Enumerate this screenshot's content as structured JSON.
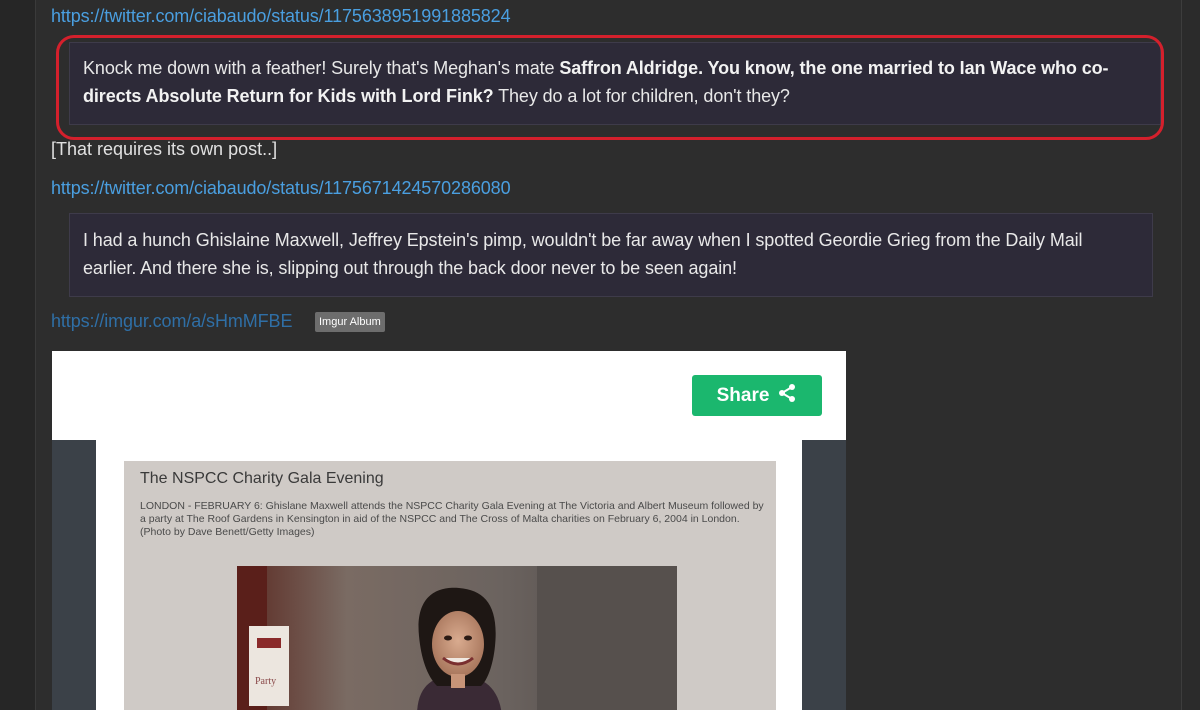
{
  "post": {
    "link1": "https://twitter.com/ciabaudo/status/1175638951991885824",
    "quote1": {
      "prefix": "Knock me down with a feather! Surely that's Meghan's mate ",
      "bold": "Saffron Aldridge. You know, the one married to Ian Wace who co-directs Absolute Return for Kids with Lord Fink?",
      "suffix": " They do a lot for children, don't they?"
    },
    "note": "[That requires its own post..]",
    "link2": "https://twitter.com/ciabaudo/status/1175671424570286080",
    "quote2": "I had a hunch Ghislaine Maxwell, Jeffrey Epstein's pimp, wouldn't be far away when I spotted Geordie Grieg from the Daily Mail earlier. And there she is, slipping out through the back door never to be seen again!",
    "link3": "https://imgur.com/a/sHmMFBE",
    "badge": "Imgur Album"
  },
  "embed": {
    "share_label": "Share",
    "share_icon": "share-icon",
    "photo_title": "The NSPCC Charity Gala Evening",
    "photo_caption": "LONDON - FEBRUARY 6: Ghislane Maxwell attends the NSPCC Charity Gala Evening at The Victoria and Albert Museum followed by a party at The Roof Gardens in Kensington in aid of the NSPCC and The Cross of Malta charities on February 6, 2004 in London. (Photo by Dave Benett/Getty Images)",
    "sign_text": "Party"
  },
  "colors": {
    "link": "#4a9fe0",
    "highlight": "#d4202c",
    "share_green": "#1bb76e",
    "quote_bg": "#2d2a38"
  }
}
